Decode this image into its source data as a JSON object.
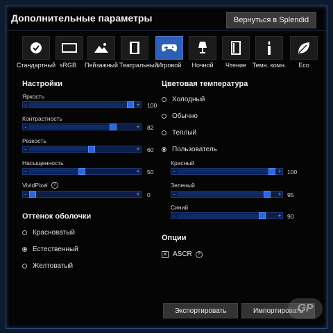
{
  "header": {
    "title": "Дополнительные параметры",
    "back_label": "Вернуться в Splendid"
  },
  "presets": [
    {
      "label": "Стандартный",
      "icon": "check-icon",
      "active": false
    },
    {
      "label": "sRGB",
      "icon": "monitor-icon",
      "active": false
    },
    {
      "label": "Пейзажный",
      "icon": "mountain-icon",
      "active": false
    },
    {
      "label": "Театральный",
      "icon": "film-icon",
      "active": false
    },
    {
      "label": "Игровой",
      "icon": "gamepad-icon",
      "active": true
    },
    {
      "label": "Ночной",
      "icon": "lamp-icon",
      "active": false
    },
    {
      "label": "Чтение",
      "icon": "book-icon",
      "active": false
    },
    {
      "label": "Темн. комн.",
      "icon": "candle-icon",
      "active": false
    },
    {
      "label": "Eco",
      "icon": "leaf-icon",
      "active": false
    }
  ],
  "settings": {
    "title": "Настройки",
    "sliders": [
      {
        "label": "Яркость",
        "value": "100"
      },
      {
        "label": "Контрастность",
        "value": "82"
      },
      {
        "label": "Резкость",
        "value": "60"
      },
      {
        "label": "Насыщенность",
        "value": "50"
      },
      {
        "label": "VividPixel",
        "value": "0",
        "help": "?"
      }
    ]
  },
  "tint": {
    "title": "Оттенок оболочки",
    "options": [
      {
        "label": "Красноватый",
        "selected": false
      },
      {
        "label": "Естественный",
        "selected": true
      },
      {
        "label": "Желтоватый",
        "selected": false
      }
    ]
  },
  "color_temp": {
    "title": "Цветовая температура",
    "options": [
      {
        "label": "Холодный",
        "selected": false
      },
      {
        "label": "Обычно",
        "selected": false
      },
      {
        "label": "Теплый",
        "selected": false
      },
      {
        "label": "Пользователь",
        "selected": true
      }
    ],
    "sliders": [
      {
        "label": "Красный",
        "value": "100"
      },
      {
        "label": "Зеленый",
        "value": "95"
      },
      {
        "label": "Синий",
        "value": "90"
      }
    ]
  },
  "options": {
    "title": "Опции",
    "asc_label": "ASCR",
    "asc_checked": true,
    "help": "?"
  },
  "footer": {
    "export_label": "Экспортировать",
    "import_label": "Импортировать"
  },
  "watermark": "GP",
  "colors": {
    "accent": "#2f5fb4",
    "slider_track": "#0c1e47",
    "thumb": "#2a66e0"
  }
}
